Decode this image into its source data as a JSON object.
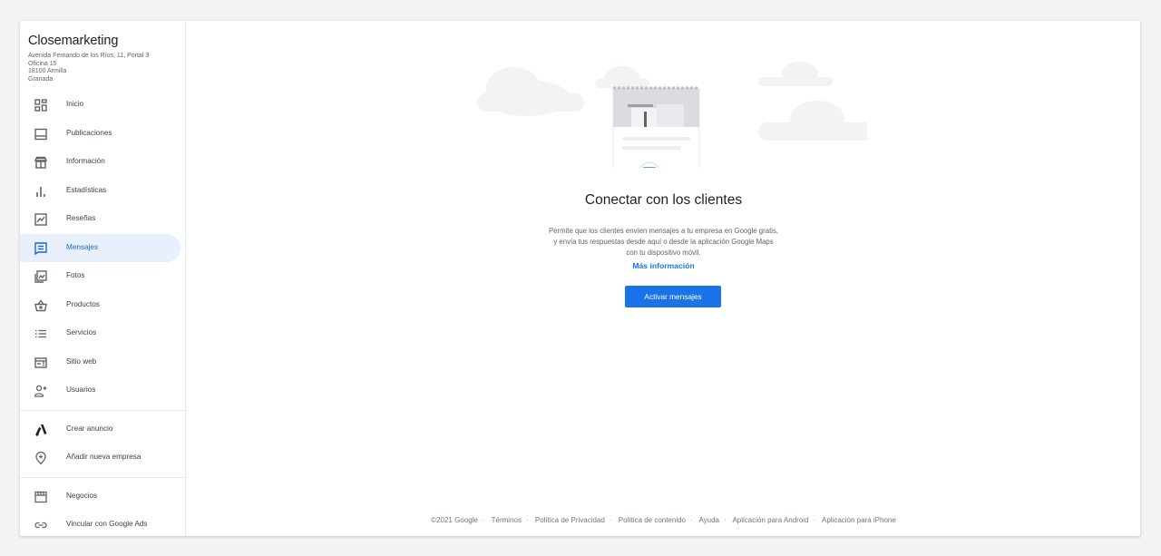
{
  "business": {
    "name": "Closemarketing",
    "address_lines": [
      "Avenida Fernando de los Ríos, 11, Portal 3",
      "Oficina 15",
      "18100 Armilla",
      "Granada"
    ]
  },
  "sidebar": {
    "items": [
      {
        "label": "Inicio",
        "icon": "dashboard-icon"
      },
      {
        "label": "Publicaciones",
        "icon": "posts-icon"
      },
      {
        "label": "Información",
        "icon": "store-info-icon"
      },
      {
        "label": "Estadísticas",
        "icon": "bar-chart-icon"
      },
      {
        "label": "Reseñas",
        "icon": "reviews-icon"
      },
      {
        "label": "Mensajes",
        "icon": "message-icon",
        "active": true
      },
      {
        "label": "Fotos",
        "icon": "photo-icon"
      },
      {
        "label": "Productos",
        "icon": "basket-icon"
      },
      {
        "label": "Servicios",
        "icon": "list-icon"
      },
      {
        "label": "Sitio web",
        "icon": "website-icon"
      },
      {
        "label": "Usuarios",
        "icon": "add-user-icon"
      }
    ],
    "secondary": [
      {
        "label": "Crear anuncio",
        "icon": "google-ads-icon"
      },
      {
        "label": "Añadir nueva empresa",
        "icon": "add-location-icon"
      }
    ],
    "tertiary": [
      {
        "label": "Negocios",
        "icon": "storefront-icon"
      },
      {
        "label": "Vincular con Google Ads",
        "icon": "link-icon"
      }
    ]
  },
  "main": {
    "heading": "Conectar con los clientes",
    "description_lines": [
      "Permite que los clientes envíen mensajes a tu empresa en Google gratis,",
      "y envía tus respuestas desde aquí o desde la aplicación Google Maps",
      "con tu dispositivo móvil."
    ],
    "more_info": "Más información",
    "cta_label": "Activar mensajes"
  },
  "footer": {
    "links": [
      "©2021 Google",
      "Términos",
      "Política de Privacidad",
      "Política de contenido",
      "Ayuda",
      "Aplicación para Android",
      "Aplicación para iPhone"
    ]
  },
  "colors": {
    "accent": "#1a73e8",
    "active_bg": "#e8f0fe",
    "active_text": "#1967d2"
  }
}
